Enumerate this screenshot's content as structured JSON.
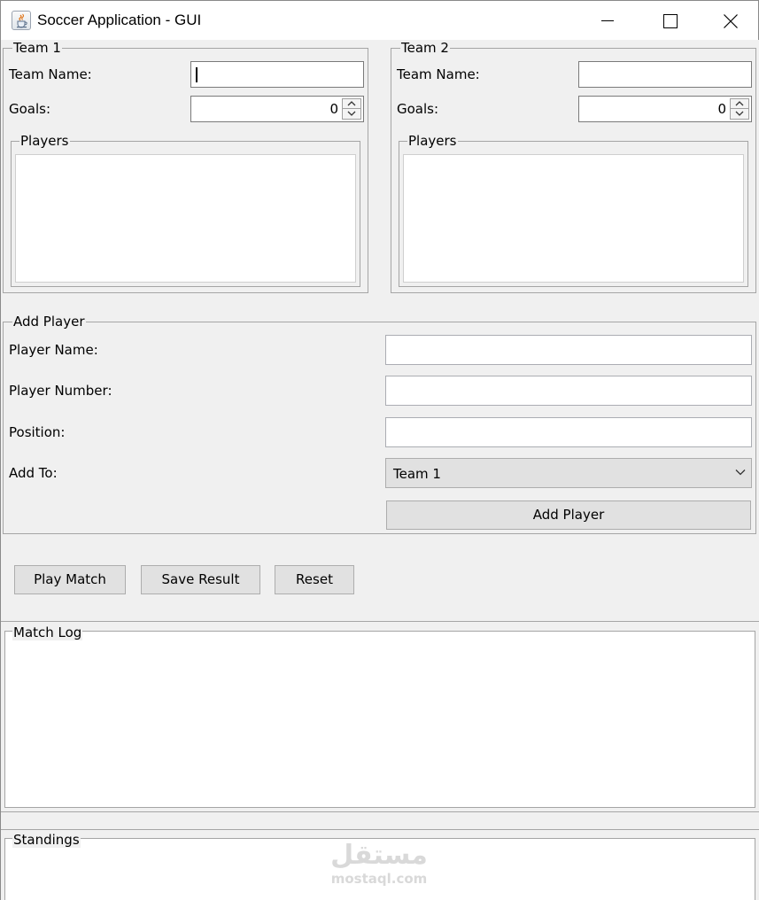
{
  "window": {
    "title": "Soccer Application - GUI",
    "icon": "java-cup-icon"
  },
  "team1": {
    "legend": "Team 1",
    "name_label": "Team Name:",
    "name_value": "",
    "goals_label": "Goals:",
    "goals_value": "0",
    "players_legend": "Players",
    "players": []
  },
  "team2": {
    "legend": "Team 2",
    "name_label": "Team Name:",
    "name_value": "",
    "goals_label": "Goals:",
    "goals_value": "0",
    "players_legend": "Players",
    "players": []
  },
  "add_player": {
    "legend": "Add Player",
    "name_label": "Player Name:",
    "name_value": "",
    "number_label": "Player Number:",
    "number_value": "",
    "position_label": "Position:",
    "position_value": "",
    "add_to_label": "Add To:",
    "add_to_selected": "Team 1",
    "button_label": "Add Player"
  },
  "actions": {
    "play_label": "Play Match",
    "save_label": "Save Result",
    "reset_label": "Reset"
  },
  "match_log": {
    "legend": "Match Log",
    "content": ""
  },
  "standings": {
    "legend": "Standings",
    "content": ""
  },
  "watermark": {
    "main": "مستقل",
    "sub": "mostaql.com"
  },
  "colors": {
    "background": "#f0f0f0",
    "border": "#a5a5a5",
    "button": "#e1e1e1",
    "field": "#ffffff"
  }
}
